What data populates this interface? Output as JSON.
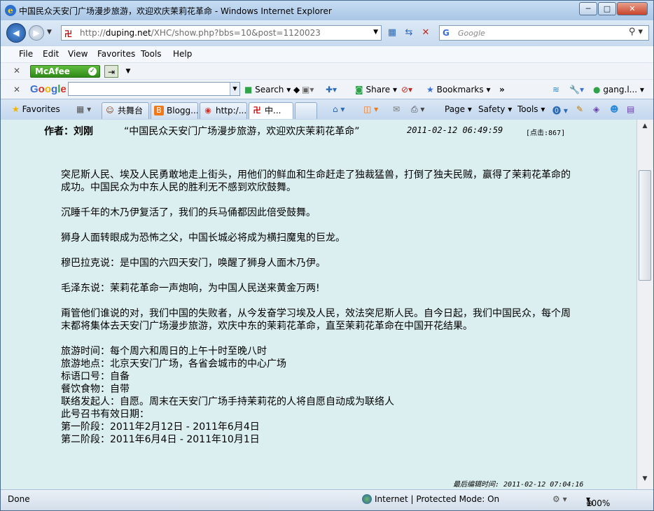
{
  "window": {
    "title": "中国民众天安门广场漫步旅游，欢迎欢庆茉莉花革命 - Windows Internet Explorer",
    "minimize": "─",
    "maximize": "□",
    "close": "✕"
  },
  "nav": {
    "url_domain": "duping.net",
    "url_prefix": "http://",
    "url_path": "/XHC/show.php?bbs=10&post=1120023",
    "search_placeholder": "Google"
  },
  "menu": [
    "File",
    "Edit",
    "View",
    "Favorites",
    "Tools",
    "Help"
  ],
  "toolbar_mcafee": {
    "label": "McAfee"
  },
  "google_toolbar": {
    "logo": "Google",
    "search": "Search",
    "share": "Share",
    "bookmarks": "Bookmarks",
    "more": "»",
    "user": "gang.l..."
  },
  "tabs": {
    "favorites": "Favorites",
    "items": [
      "共舞台",
      "Blogg...",
      "http:/...",
      "中..."
    ],
    "commands": [
      "Page",
      "Safety",
      "Tools"
    ]
  },
  "post": {
    "author": "作者：刘刚",
    "title": "“中国民众天安门广场漫步旅游，欢迎欢庆茉莉花革命”",
    "date": "2011-02-12 06:49:59",
    "clicks": "[点击:867]",
    "paragraphs": [
      "突尼斯人民、埃及人民勇敢地走上街头，用他们的鲜血和生命赶走了独裁猛兽，打倒了独夫民贼，赢得了茉莉花革命的成功。中国民众为中东人民的胜利无不感到欢欣鼓舞。",
      "沉睡千年的木乃伊复活了，我们的兵马俑都因此倍受鼓舞。",
      "狮身人面转眼成为恐怖之父，中国长城必将成为横扫魔鬼的巨龙。",
      "穆巴拉克说：是中国的六四天安门，唤醒了狮身人面木乃伊。",
      "毛泽东说：茉莉花革命一声炮响，为中国人民送来黄金万两!",
      "甭管他们谁说的对，我们中国的失败者，从今发奋学习埃及人民，效法突尼斯人民。自今日起，我们中国民众，每个周末都将集体去天安门广场漫步旅游，欢庆中东的茉莉花革命，直至茉莉花革命在中国开花结果。"
    ],
    "details": [
      "旅游时间：每个周六和周日的上午十时至晚八时",
      "旅游地点：北京天安门广场，各省会城市的中心广场",
      "标语口号：自备",
      "餐饮食物：自带",
      "联络发起人：自愿。周末在天安门广场手持茉莉花的人将自愿自动成为联络人",
      "此号召书有效日期：",
      "第一阶段：2011年2月12日 - 2011年6月4日",
      "第二阶段：2011年6月4日 - 2011年10月1日"
    ],
    "edited": "最后编辑时间: 2011-02-12 07:04:16"
  },
  "status": {
    "left": "Done",
    "zone": "Internet | Protected Mode: On",
    "zoom": "100%"
  }
}
